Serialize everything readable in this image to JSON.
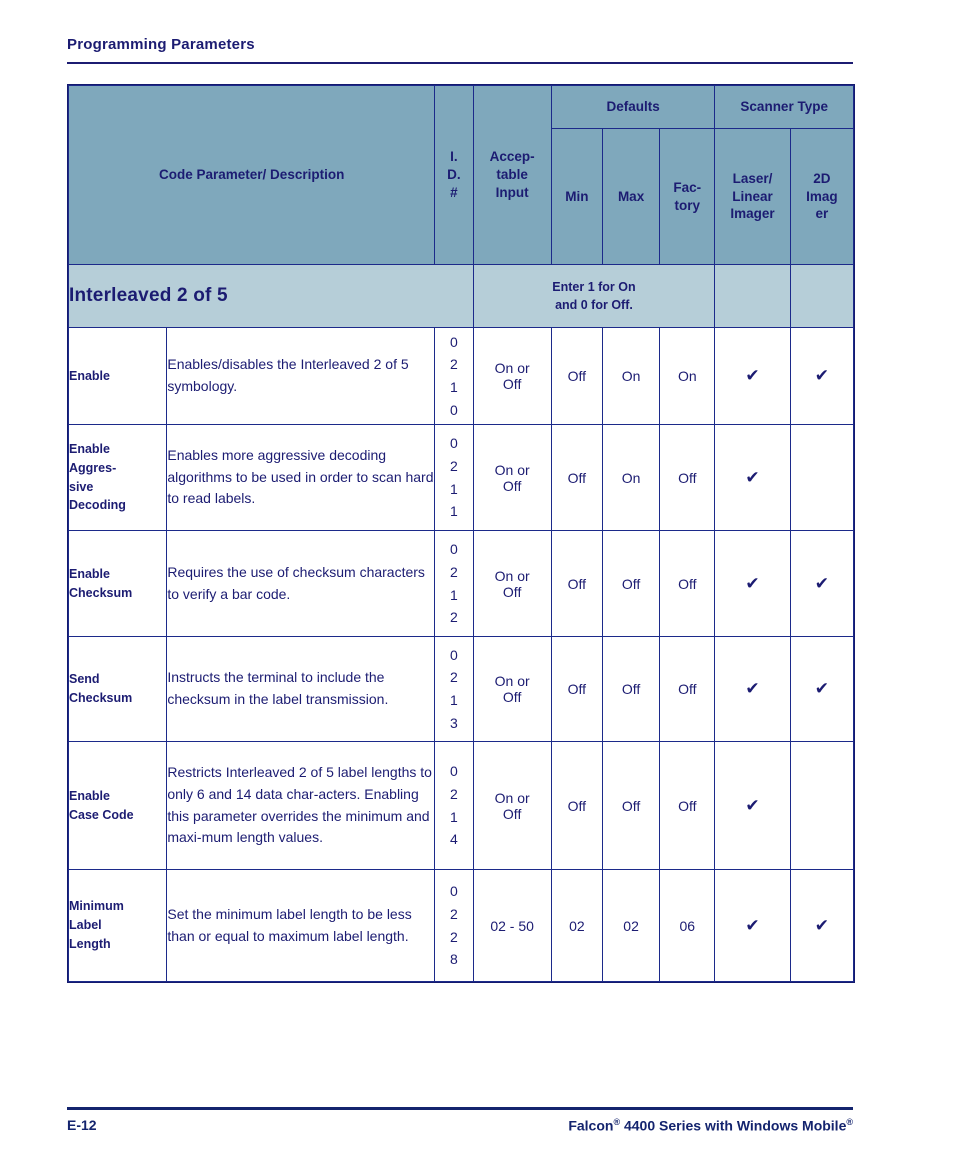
{
  "running_head": "Programming Parameters",
  "table": {
    "headers": {
      "code_parameter": "Code Parameter/ Description",
      "id_number": "I.\nD.\n#",
      "acceptable_input": "Accep-\ntable\nInput",
      "defaults_group": "Defaults",
      "scanner_type_group": "Scanner Type",
      "min": "Min",
      "max": "Max",
      "factory": "Fac-\ntory",
      "laser_linear_imager": "Laser/\nLinear\nImager",
      "two_d_imager": "2D\nImag\ner"
    },
    "section": {
      "title": "Interleaved 2 of 5",
      "note": "Enter 1 for On\nand 0 for Off."
    },
    "rows": [
      {
        "parameter": "Enable",
        "description": "Enables/disables the Interleaved 2 of 5 symbology.",
        "id": "0\n2\n1\n0",
        "acceptable_input": "On or\nOff",
        "min": "Off",
        "max": "On",
        "factory": "On",
        "laser_linear_imager": "✔",
        "two_d_imager": "✔"
      },
      {
        "parameter": "Enable\nAggres-\nsive\nDecoding",
        "description": "Enables more aggressive decoding algorithms to be used in order to scan hard to read labels.",
        "id": "0\n2\n1\n1",
        "acceptable_input": "On or\nOff",
        "min": "Off",
        "max": "On",
        "factory": "Off",
        "laser_linear_imager": "✔",
        "two_d_imager": ""
      },
      {
        "parameter": "Enable\nChecksum",
        "description": "Requires the use of checksum characters to verify a bar code.",
        "id": "0\n2\n1\n2",
        "acceptable_input": "On or\nOff",
        "min": "Off",
        "max": "Off",
        "factory": "Off",
        "laser_linear_imager": "✔",
        "two_d_imager": "✔"
      },
      {
        "parameter": "Send\nChecksum",
        "description": "Instructs the terminal to include the checksum in the label transmission.",
        "id": "0\n2\n1\n3",
        "acceptable_input": "On or\nOff",
        "min": "Off",
        "max": "Off",
        "factory": "Off",
        "laser_linear_imager": "✔",
        "two_d_imager": "✔"
      },
      {
        "parameter": "Enable\nCase Code",
        "description": "Restricts Interleaved 2 of 5 label lengths to only 6 and 14 data char-acters. Enabling this parameter overrides the minimum and maxi-mum length values.",
        "id": "0\n2\n1\n4",
        "acceptable_input": "On or\nOff",
        "min": "Off",
        "max": "Off",
        "factory": "Off",
        "laser_linear_imager": "✔",
        "two_d_imager": ""
      },
      {
        "parameter": "Minimum\nLabel\nLength",
        "description": "Set the minimum label length to be less than or equal to maximum label length.",
        "id": "0\n2\n2\n8",
        "acceptable_input": "02 - 50",
        "min": "02",
        "max": "02",
        "factory": "06",
        "laser_linear_imager": "✔",
        "two_d_imager": "✔"
      }
    ]
  },
  "footer": {
    "page_number": "E-12",
    "product_prefix": "Falcon",
    "product_mid": " 4400 Series with Windows Mobile",
    "registered_mark": "®"
  },
  "colors": {
    "header_band": "#7FA8BC",
    "section_band": "#B6CED8",
    "text": "#14246E",
    "border": "#1C2A8A"
  }
}
